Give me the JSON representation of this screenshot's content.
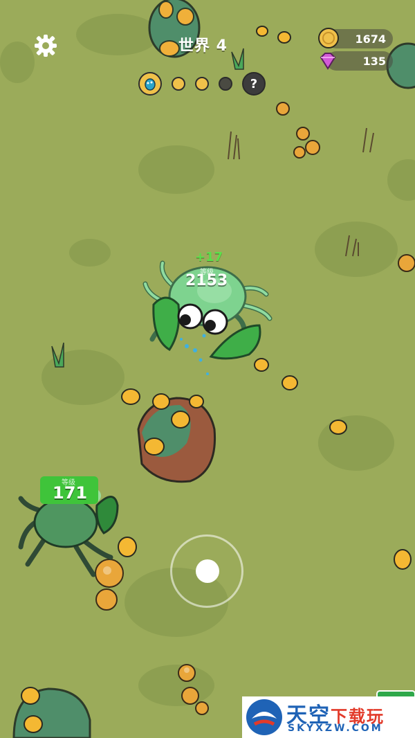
{
  "hud": {
    "world_title": "世界 4",
    "coins": "1674",
    "gems": "135",
    "progress_hint": "?"
  },
  "player": {
    "gain": "+17",
    "score": "2153",
    "level_tag": "等级"
  },
  "enemy": {
    "level_tag": "等级",
    "score": "171"
  },
  "watermark": {
    "title_a": "天空",
    "title_b": "下载玩",
    "domain": "SKYXZW.COM"
  },
  "colors": {
    "grass": "#9bab5a",
    "coin": "#f0c14a",
    "gem": "#d35ad6",
    "player_green": "#7ed38f",
    "enemy_badge": "#3fc43a"
  }
}
